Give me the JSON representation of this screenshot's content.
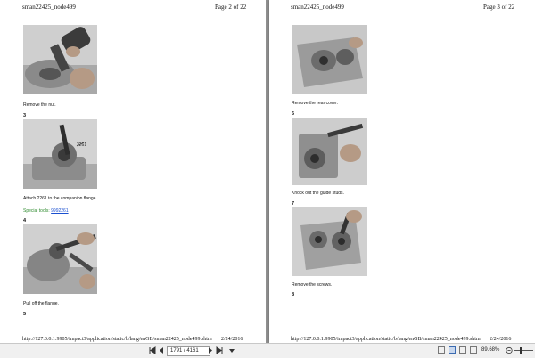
{
  "left_page": {
    "header_title": "sman22425_node499",
    "header_page": "Page 2 of 22",
    "step1_caption": "Remove the nut.",
    "step3_num": "3",
    "callout_2261": "2261",
    "step3_caption": "Attach 2261 to the companion flange.",
    "special_tools_label": "Special tools:",
    "special_tools_link": "9992261",
    "step4_num": "4",
    "step4_caption": "Pull off the flange.",
    "step5_num": "5",
    "footer_url": "http://127.0.0.1:9905/impact3/application/static/b/lang/enGB/sman22425_node499.shtm",
    "footer_date": "2/24/2016"
  },
  "right_page": {
    "header_title": "sman22425_node499",
    "header_page": "Page 3 of 22",
    "step5_caption": "Remove the rear cover.",
    "step6_num": "6",
    "step6_caption": "Knock out the guide studs.",
    "step7_num": "7",
    "step7_caption": "Remove the screws.",
    "step8_num": "8",
    "footer_url": "http://127.0.0.1:9905/impact3/application/static/b/lang/enGB/sman22425_node499.shtm",
    "footer_date": "2/24/2016"
  },
  "toolbar": {
    "first_icon": "first-page-icon",
    "prev_icon": "prev-page-icon",
    "page_display": "1791 / 4161",
    "next_icon": "next-page-icon",
    "last_icon": "last-page-icon",
    "zoom_value": "89.68%",
    "zoom_fraction": 0.35
  }
}
